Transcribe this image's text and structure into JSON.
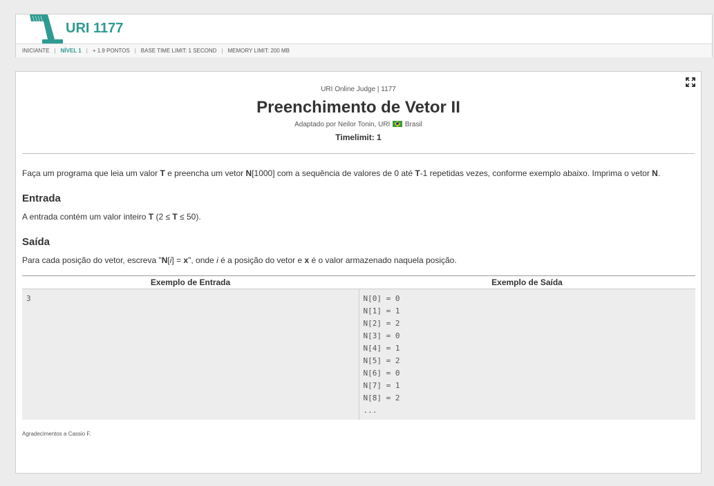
{
  "header": {
    "problem_code": "URI 1177",
    "meta": {
      "category": "INICIANTE",
      "level": "NÍVEL 1",
      "points": "+ 1.9 PONTOS",
      "time_limit": "BASE TIME LIMIT: 1 SECOND",
      "memory_limit": "MEMORY LIMIT: 200 MB"
    }
  },
  "problem": {
    "judge": "URI Online Judge | 1177",
    "title": "Preenchimento de Vetor II",
    "author_prefix": "Adaptado por Neilor Tonin, URI",
    "country": "Brasil",
    "timelimit": "Timelimit: 1",
    "description": {
      "p1": "Faça um programa que leia um valor ",
      "T": "T",
      "p2": " e preencha um vetor ",
      "N": "N",
      "p3": "[1000] com a sequência de valores de 0 até ",
      "T2": "T",
      "p4": "-1 repetidas vezes, conforme exemplo abaixo. Imprima o vetor ",
      "N2": "N",
      "p5": "."
    },
    "input_heading": "Entrada",
    "input": {
      "p1": "A entrada contém um valor inteiro ",
      "T": "T",
      "p2": " (2 ≤ ",
      "T2": "T",
      "p3": " ≤ 50)."
    },
    "output_heading": "Saída",
    "output": {
      "p1": "Para cada posição do vetor, escreva \"",
      "N": "N",
      "b1": "[",
      "i": "i",
      "b2": "] = ",
      "x": "x",
      "p2": "\", onde ",
      "i2": "i",
      "p3": " é a posição do vetor e ",
      "x2": "x",
      "p4": " é o valor armazenado naquela posição."
    },
    "sample_input_header": "Exemplo de Entrada",
    "sample_output_header": "Exemplo de Saída",
    "sample_input": "3",
    "sample_output": [
      "N[0] = 0",
      "N[1] = 1",
      "N[2] = 2",
      "N[3] = 0",
      "N[4] = 1",
      "N[5] = 2",
      "N[6] = 0",
      "N[7] = 1",
      "N[8] = 2",
      "..."
    ],
    "thanks": "Agradecimentos a Cassio F."
  }
}
